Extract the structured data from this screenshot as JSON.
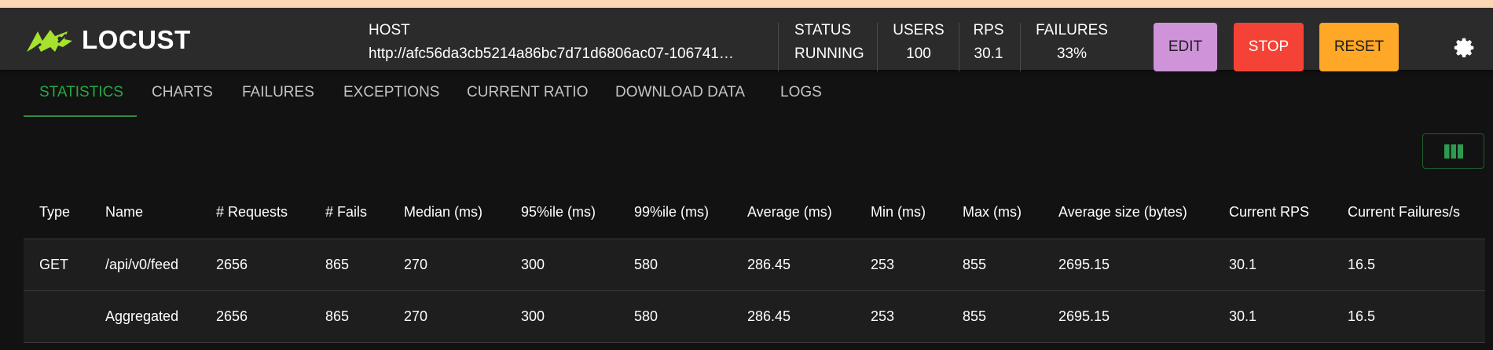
{
  "app": {
    "name": "LOCUST"
  },
  "header": {
    "host_label": "HOST",
    "host_value": "http://afc56da3cb5214a86bc7d71d6806ac07-106741…",
    "status_label": "STATUS",
    "status_value": "RUNNING",
    "users_label": "USERS",
    "users_value": "100",
    "rps_label": "RPS",
    "rps_value": "30.1",
    "failures_label": "FAILURES",
    "failures_value": "33%"
  },
  "buttons": {
    "edit": "EDIT",
    "stop": "STOP",
    "reset": "RESET"
  },
  "tabs": [
    {
      "label": "STATISTICS",
      "active": true
    },
    {
      "label": "CHARTS"
    },
    {
      "label": "FAILURES"
    },
    {
      "label": "EXCEPTIONS"
    },
    {
      "label": "CURRENT RATIO"
    },
    {
      "label": "DOWNLOAD DATA"
    },
    {
      "label": "LOGS"
    }
  ],
  "table": {
    "columns": [
      "Type",
      "Name",
      "# Requests",
      "# Fails",
      "Median (ms)",
      "95%ile (ms)",
      "99%ile (ms)",
      "Average (ms)",
      "Min (ms)",
      "Max (ms)",
      "Average size (bytes)",
      "Current RPS",
      "Current Failures/s"
    ],
    "rows": [
      [
        "GET",
        "/api/v0/feed",
        "2656",
        "865",
        "270",
        "300",
        "580",
        "286.45",
        "253",
        "855",
        "2695.15",
        "30.1",
        "16.5"
      ],
      [
        "",
        "Aggregated",
        "2656",
        "865",
        "270",
        "300",
        "580",
        "286.45",
        "253",
        "855",
        "2695.15",
        "30.1",
        "16.5"
      ]
    ]
  },
  "icons": {
    "logo": "locust-logo-icon",
    "settings": "gear-icon",
    "columns": "columns-icon"
  },
  "colors": {
    "accent": "#28a745",
    "edit": "#ce93d8",
    "stop": "#f44336",
    "reset": "#ffa726",
    "logo": "#a6e22e"
  }
}
